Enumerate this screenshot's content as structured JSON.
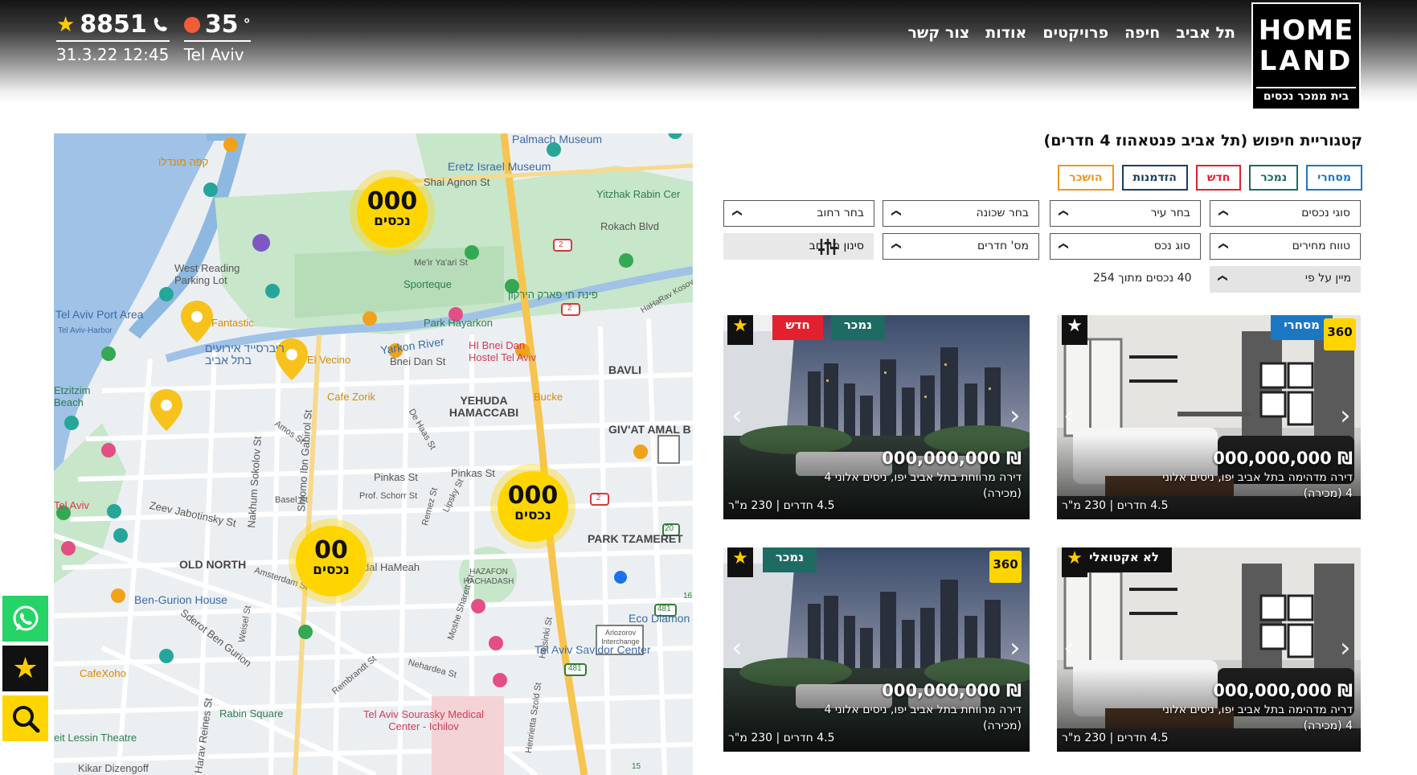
{
  "brand": {
    "logo_line1": "HOME",
    "logo_line2": "LAND",
    "tagline": "בית ממכר נכסים"
  },
  "nav": {
    "items": [
      "תל אביב",
      "חיפה",
      "פרויקטים",
      "אודות",
      "צור קשר"
    ]
  },
  "topbar": {
    "phone": "8851",
    "datetime": "31.3.22 12:45",
    "temperature": "35",
    "degree_symbol": "°",
    "city": "Tel Aviv"
  },
  "search": {
    "title": "קטגוריית חיפוש (תל אביב פנטאהוז 4 חדרים)",
    "tags": [
      {
        "label": "מסחרי",
        "color": "#1c77c3"
      },
      {
        "label": "נמכר",
        "color": "#1e6b63"
      },
      {
        "label": "חדש",
        "color": "#e3202e"
      },
      {
        "label": "הזדמנות",
        "color": "#1c3f5e"
      },
      {
        "label": "הושכר",
        "color": "#f0961c"
      }
    ],
    "filters": {
      "property_types": "סוגי נכסים",
      "city": "בחר עיר",
      "neighborhood": "בחר שכונה",
      "street": "בחר רחוב",
      "price_range": "טווח מחירים",
      "property_kind": "סוג נכס",
      "rooms": "מס' חדרים",
      "advanced": "סינון מורחב"
    },
    "sort": "מיין על פי",
    "results_count": "40 נכסים מתוך 254"
  },
  "map": {
    "clusters": [
      {
        "count": "000",
        "label": "נכסים"
      },
      {
        "count": "000",
        "label": "נכסים"
      },
      {
        "count": "00",
        "label": "נכסים"
      }
    ],
    "labels": [
      "Palmach Museum",
      "Eretz Israel Museum",
      "Shai Agnon St",
      "Yitzhak Rabin Cer",
      "Rokach Blvd",
      "West Reading Parking Lot",
      "Tel Aviv Port Area",
      "Tel Aviv-Harbor",
      "Me'ir Ya'ari St",
      "Sporteque",
      "פינת חי פארק הירקון",
      "Park Hayarkon",
      "Yarkon River",
      "Bnei Dan St",
      "HI Bnei Dan Hostel Tel Aviv",
      "Fantastic",
      "ריברסייד אירועים בתל אביב",
      "El Vecino",
      "BAVLI",
      "Cafe Zorik",
      "YEHUDA HAMACCABI",
      "Bucke",
      "GIV'AT AMAL B",
      "Etzitzim Beach",
      "Tel Aviv",
      "Pinkas St",
      "Zeev Jabotinsky St",
      "Basel St",
      "Prof. Schorr St",
      "PARK TZAMERET",
      "OLD NORTH",
      "Shlomo Ibn Gabirol St",
      "Nakhum Sokolov St",
      "Amsterdam St",
      "Dizengoff",
      "Ben-Gurion House",
      "HAZAFON HACHADASH",
      "Eco Diamon",
      "Tel Aviv Savidor Center",
      "Sderot Ben Gurion",
      "Rembrandt St",
      "Nehardea St",
      "CafeXoho",
      "Rabin Square",
      "Tel Aviv Sourasky Medical Center - Ichilov",
      "Arlozorov Interchange",
      "eit Lessin Theatre",
      "Kikar Dizengoff",
      "Harav Reines St",
      "Weisel St",
      "Henrietta Szold St",
      "Helsinki St",
      "Moshe Sharett St",
      "Remez St",
      "Lipsky St",
      "De Haas St",
      "Amos St",
      "HaHaRav Kosovs",
      "קפה מונדלו",
      "dal HaMeah",
      "2",
      "481",
      "20",
      "16",
      "15"
    ]
  },
  "cards": [
    {
      "badges": [
        {
          "label": "מסחרי",
          "color": "#1c77c3"
        }
      ],
      "fav": "white",
      "show360": true,
      "price": "₪ 000,000,000",
      "description": "דירה מדהימה בתל אביב יפו, ניסים אלוני 4 (מכירה)",
      "meta": "4.5 חדרים | 230 מ\"ר",
      "scene": "interior"
    },
    {
      "badges": [
        {
          "label": "נמכר",
          "color": "#1e6b63"
        },
        {
          "label": "חדש",
          "color": "#e3202e"
        }
      ],
      "fav": "gold",
      "show360": false,
      "price": "₪ 000,000,000",
      "description": "דירה מרווחת בתל אביב יפו, ניסים אלוני 4 (מכירה)",
      "meta": "4.5 חדרים | 230 מ\"ר",
      "scene": "skyline"
    },
    {
      "badges": [
        {
          "label": "לא אקטואלי",
          "color": "#111111"
        }
      ],
      "fav": "gold",
      "show360": false,
      "price": "₪ 000,000,000",
      "description": "דריה מדהימה בתל אביב יפו, ניסים אלוני 4 (מכירה)",
      "meta": "4.5 חדרים | 230 מ\"ר",
      "scene": "interior"
    },
    {
      "badges": [
        {
          "label": "נמכר",
          "color": "#1e6b63"
        }
      ],
      "fav": "gold",
      "show360": true,
      "price": "₪ 000,000,000",
      "description": "דירה מרווחת בתל אביב יפו, ניסים אלוני 4 (מכירה)",
      "meta": "4.5 חדרים | 230 מ\"ר",
      "scene": "skyline"
    }
  ],
  "side_actions": [
    {
      "icon": "whatsapp-icon",
      "color": "#25d366"
    },
    {
      "icon": "star-icon",
      "color": "#111111"
    },
    {
      "icon": "search-icon",
      "color": "#ffd500"
    }
  ],
  "label_360": "360"
}
